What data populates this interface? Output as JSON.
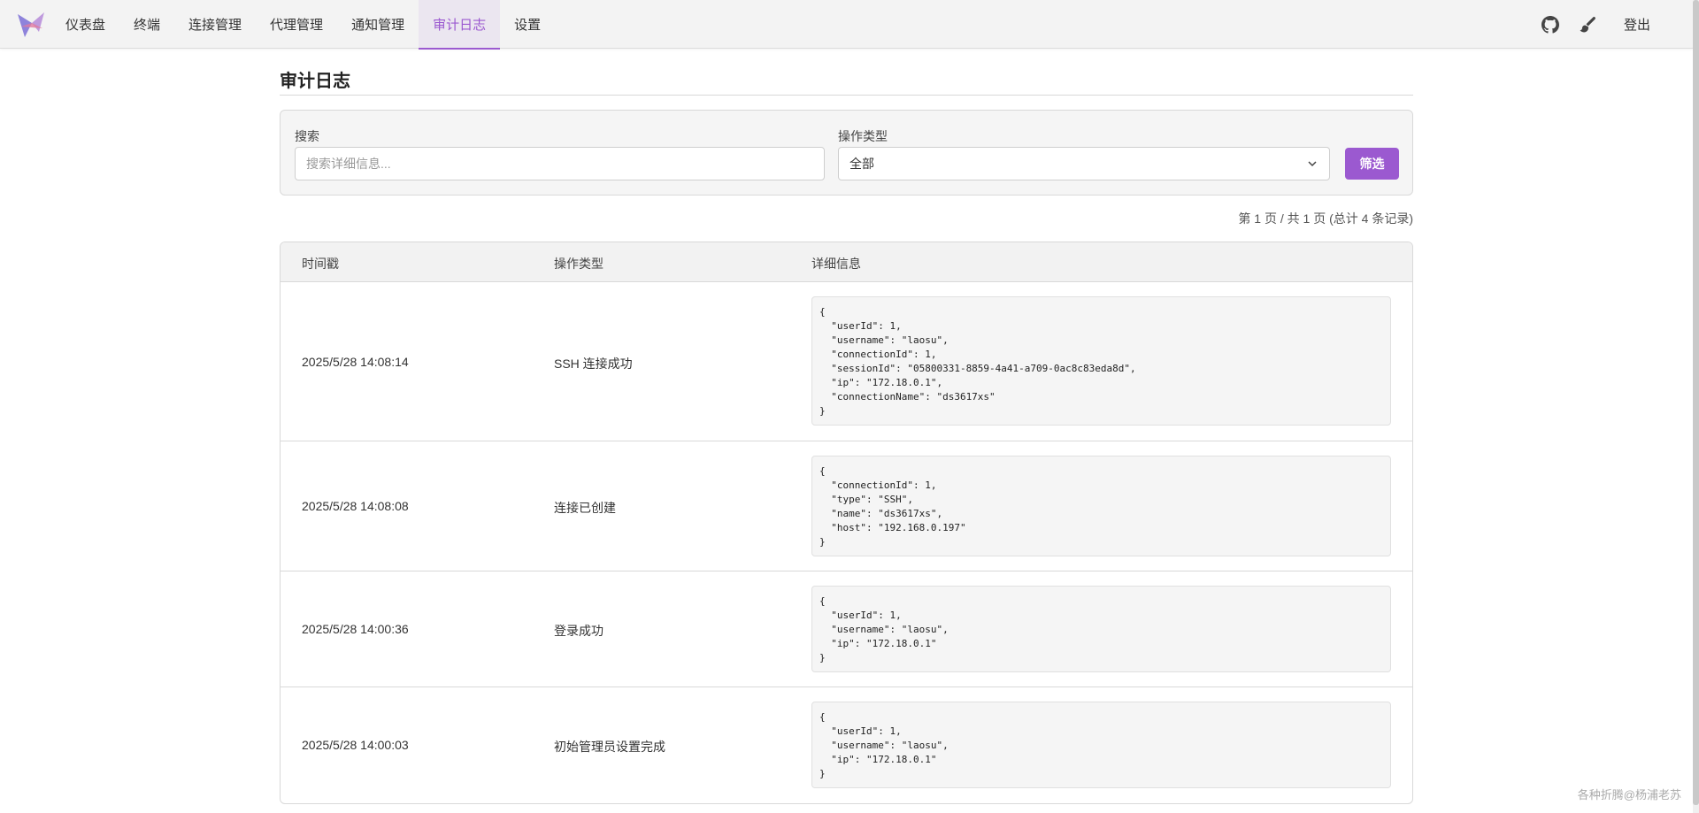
{
  "nav": {
    "items": [
      {
        "label": "仪表盘"
      },
      {
        "label": "终端"
      },
      {
        "label": "连接管理"
      },
      {
        "label": "代理管理"
      },
      {
        "label": "通知管理"
      },
      {
        "label": "审计日志",
        "active": true
      },
      {
        "label": "设置"
      }
    ],
    "logout_label": "登出",
    "icons": [
      "github-icon",
      "brush-icon"
    ]
  },
  "page": {
    "title": "审计日志"
  },
  "filter": {
    "search_label": "搜索",
    "search_placeholder": "搜索详细信息...",
    "type_label": "操作类型",
    "type_value": "全部",
    "filter_button": "筛选"
  },
  "pagination": {
    "info": "第 1 页 / 共 1 页 (总计 4 条记录)"
  },
  "table": {
    "headers": {
      "timestamp": "时间戳",
      "action": "操作类型",
      "details": "详细信息"
    },
    "rows": [
      {
        "timestamp": "2025/5/28 14:08:14",
        "action": "SSH 连接成功",
        "details": "{\n  \"userId\": 1,\n  \"username\": \"laosu\",\n  \"connectionId\": 1,\n  \"sessionId\": \"05800331-8859-4a41-a709-0ac8c83eda8d\",\n  \"ip\": \"172.18.0.1\",\n  \"connectionName\": \"ds3617xs\"\n}"
      },
      {
        "timestamp": "2025/5/28 14:08:08",
        "action": "连接已创建",
        "details": "{\n  \"connectionId\": 1,\n  \"type\": \"SSH\",\n  \"name\": \"ds3617xs\",\n  \"host\": \"192.168.0.197\"\n}"
      },
      {
        "timestamp": "2025/5/28 14:00:36",
        "action": "登录成功",
        "details": "{\n  \"userId\": 1,\n  \"username\": \"laosu\",\n  \"ip\": \"172.18.0.1\"\n}"
      },
      {
        "timestamp": "2025/5/28 14:00:03",
        "action": "初始管理员设置完成",
        "details": "{\n  \"userId\": 1,\n  \"username\": \"laosu\",\n  \"ip\": \"172.18.0.1\"\n}"
      }
    ]
  },
  "watermark": "各种折腾@杨浦老苏",
  "colors": {
    "accent": "#9b59d0",
    "topbar_bg": "#f3f3f3"
  }
}
